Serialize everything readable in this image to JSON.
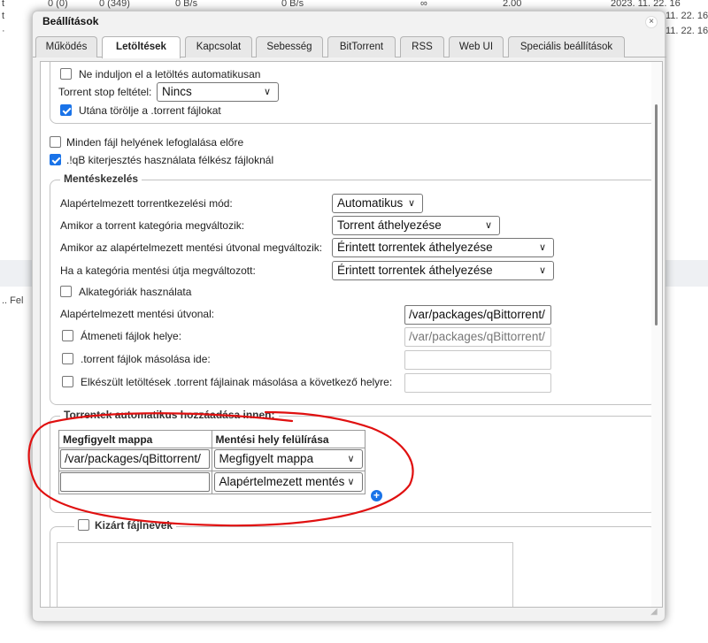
{
  "background": {
    "top_rows": [
      {
        "c1": "t",
        "c2": "0 (0)",
        "c3": "0 (349)",
        "c4": "0 B/s",
        "c5": "0 B/s",
        "c6": "∞",
        "c7": "2.00",
        "c8": "2023. 11. 22. 16"
      },
      {
        "c1": "t",
        "c8": "11. 22. 16"
      },
      {
        "c1": "·",
        "c8": "11. 22. 16"
      }
    ],
    "side_text": "..  Fel"
  },
  "dialog": {
    "title": "Beállítások",
    "close_glyph": "×",
    "tabs": [
      {
        "label": "Működés"
      },
      {
        "label": "Letöltések"
      },
      {
        "label": "Kapcsolat"
      },
      {
        "label": "Sebesség"
      },
      {
        "label": "BitTorrent"
      },
      {
        "label": "RSS"
      },
      {
        "label": "Web UI"
      },
      {
        "label": "Speciális beállítások"
      }
    ],
    "active_tab": "Letöltések"
  },
  "top_group": {
    "dont_start_label": "Ne induljon el a letöltés automatikusan",
    "dont_start_checked": false,
    "stop_condition_label": "Torrent stop feltétel:",
    "stop_condition_value": "Nincs",
    "delete_torrent_label": "Utána törölje a .torrent fájlokat",
    "delete_torrent_checked": true
  },
  "preallocate_label": "Minden fájl helyének lefoglalása előre",
  "preallocate_checked": false,
  "extension_label": ".!qB kiterjesztés használata félkész fájloknál",
  "extension_checked": true,
  "save_management": {
    "legend": "Mentéskezelés",
    "default_mode_label": "Alapértelmezett torrentkezelési mód:",
    "default_mode_value": "Automatikus",
    "category_changed_label": "Amikor a torrent kategória megváltozik:",
    "category_changed_value": "Torrent áthelyezése",
    "default_path_changed_label": "Amikor az alapértelmezett mentési útvonal megváltozik:",
    "default_path_changed_value": "Érintett torrentek áthelyezése",
    "category_path_changed_label": "Ha a kategória mentési útja megváltozott:",
    "category_path_changed_value": "Érintett torrentek áthelyezése",
    "subcategories_label": "Alkategóriák használata",
    "subcategories_checked": false,
    "default_save_path_label": "Alapértelmezett mentési útvonal:",
    "default_save_path_value": "/var/packages/qBittorrent/",
    "temp_path_label": "Átmeneti fájlok helye:",
    "temp_path_value": "/var/packages/qBittorrent/",
    "temp_path_checked": false,
    "copy_torrent_label": ".torrent fájlok másolása ide:",
    "copy_torrent_checked": false,
    "copy_finished_label": "Elkészült letöltések .torrent fájlainak másolása a következő helyre:",
    "copy_finished_checked": false
  },
  "auto_add": {
    "legend": "Torrentek automatikus hozzáadása innen:",
    "col_folder": "Megfigyelt mappa",
    "col_override": "Mentési hely felülírása",
    "rows": [
      {
        "folder": "/var/packages/qBittorrent/",
        "override": "Megfigyelt mappa"
      },
      {
        "folder": "",
        "override": "Alapértelmezett mentés"
      }
    ],
    "add_glyph": "+"
  },
  "excluded": {
    "legend": "Kizárt fájlnevek",
    "checked": false
  },
  "colors": {
    "accent": "#1a73e8",
    "annotation": "#e01010"
  }
}
